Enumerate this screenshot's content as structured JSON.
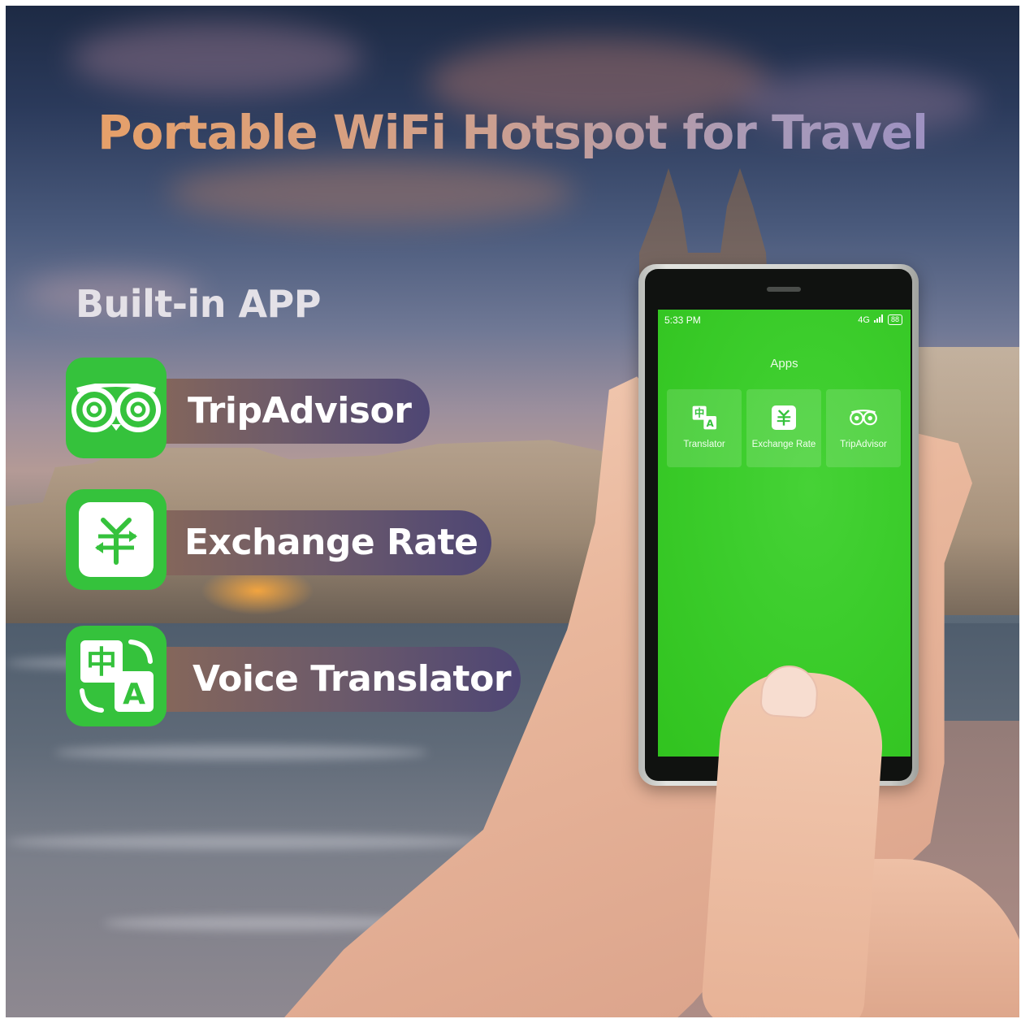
{
  "title": "Portable WiFi Hotspot for Travel",
  "subtitle": "Built-in APP",
  "features": [
    {
      "label": "TripAdvisor",
      "icon": "owl-icon"
    },
    {
      "label": "Exchange Rate",
      "icon": "yuan-exchange-icon"
    },
    {
      "label": "Voice Translator",
      "icon": "translate-icon"
    }
  ],
  "phone": {
    "time": "5:33 PM",
    "network": "4G",
    "battery": "88",
    "screen_title": "Apps",
    "apps": [
      {
        "label": "Translator",
        "icon": "translate-icon"
      },
      {
        "label": "Exchange Rate",
        "icon": "yuan-exchange-icon"
      },
      {
        "label": "TripAdvisor",
        "icon": "owl-icon"
      }
    ]
  },
  "colors": {
    "app_green": "#35c23c",
    "screen_green": "#3ccd2c",
    "pill_start": "#8c6a56",
    "pill_end": "#4e4674"
  }
}
